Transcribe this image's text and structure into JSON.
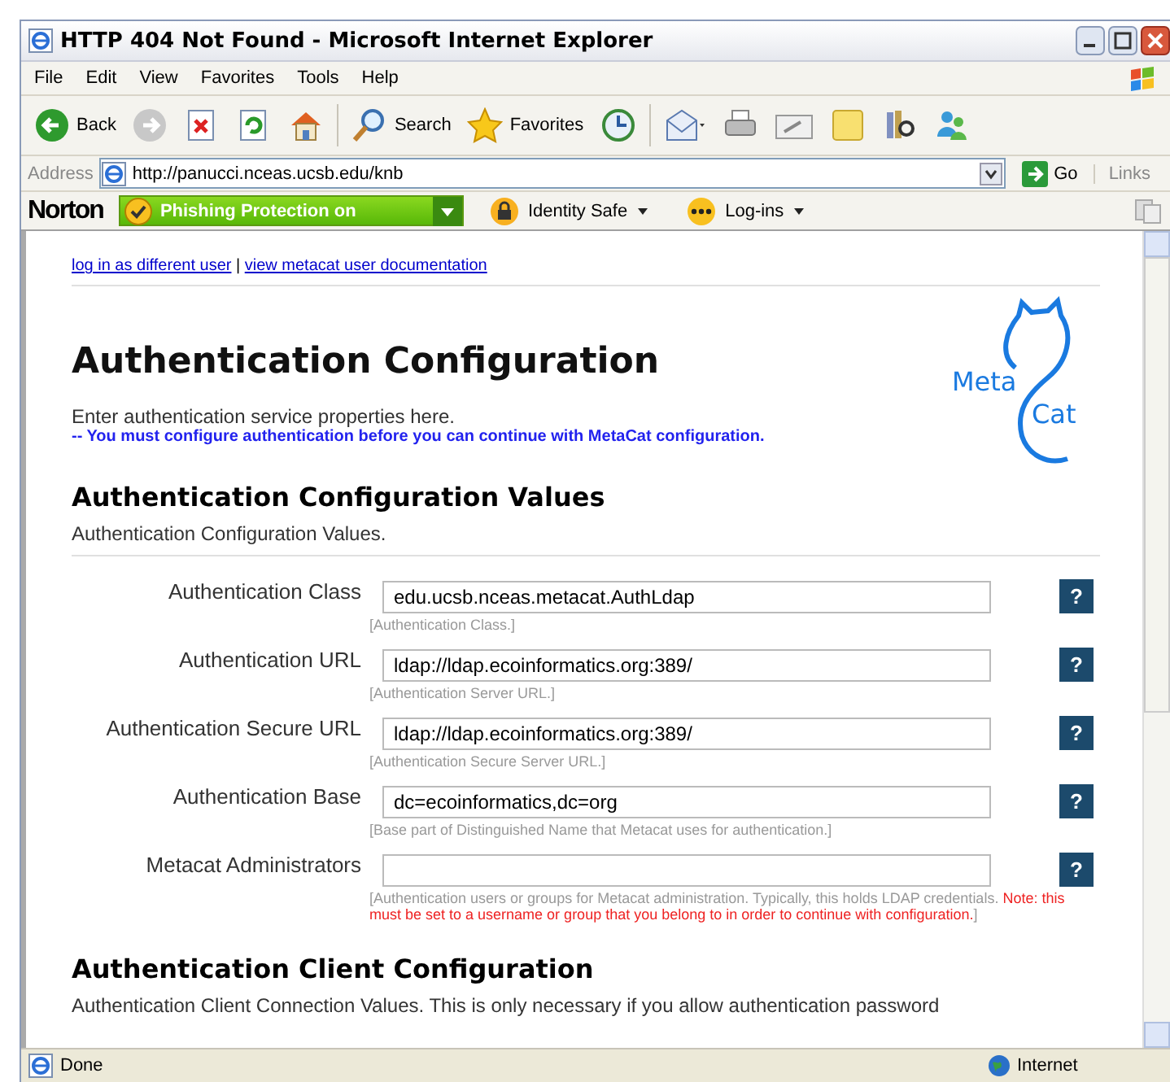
{
  "window": {
    "title": "HTTP 404 Not Found - Microsoft Internet Explorer"
  },
  "menu": [
    "File",
    "Edit",
    "View",
    "Favorites",
    "Tools",
    "Help"
  ],
  "toolbar": [
    {
      "kind": "back",
      "label": "Back"
    },
    {
      "kind": "forward"
    },
    {
      "kind": "stop"
    },
    {
      "kind": "refresh"
    },
    {
      "kind": "home"
    },
    {
      "kind": "search",
      "label": "Search"
    },
    {
      "kind": "favorites",
      "label": "Favorites"
    },
    {
      "kind": "history"
    },
    {
      "kind": "mail"
    },
    {
      "kind": "print"
    },
    {
      "kind": "edit"
    },
    {
      "kind": "note"
    },
    {
      "kind": "research"
    },
    {
      "kind": "messenger"
    }
  ],
  "address_bar": {
    "label": "Address",
    "url": "http://panucci.nceas.ucsb.edu/knb",
    "go": "Go",
    "links": "Links"
  },
  "norton_bar": {
    "brand": "Norton",
    "phishing": "Phishing Protection on",
    "identity": "Identity Safe",
    "logins": "Log-ins"
  },
  "page": {
    "top_links": [
      "log in as different user",
      "view metacat user documentation"
    ],
    "link_separator": "|",
    "title": "Authentication Configuration",
    "intro": "Enter authentication service properties here.",
    "warning": "--  You must configure authentication before you can continue with MetaCat configuration.",
    "logo": {
      "line1": "Meta",
      "line2": "Cat"
    },
    "section1": {
      "title": "Authentication Configuration Values",
      "description": "Authentication Configuration Values."
    },
    "fields": [
      {
        "label": "Authentication Class",
        "help": "?",
        "value": "edu.ucsb.nceas.metacat.AuthLdap",
        "hint": [
          {
            "kind": "plain",
            "text": "[Authentication Class.]"
          }
        ]
      },
      {
        "label": "Authentication URL",
        "help": "?",
        "value": "ldap://ldap.ecoinformatics.org:389/",
        "hint": [
          {
            "kind": "plain",
            "text": "[Authentication Server URL.]"
          }
        ]
      },
      {
        "label": "Authentication Secure URL",
        "help": "?",
        "value": "ldap://ldap.ecoinformatics.org:389/",
        "hint": [
          {
            "kind": "plain",
            "text": "[Authentication Secure Server URL.]"
          }
        ]
      },
      {
        "label": "Authentication Base",
        "help": "?",
        "value": "dc=ecoinformatics,dc=org",
        "hint": [
          {
            "kind": "plain",
            "text": "[Base part of Distinguished Name that Metacat uses for authentication.]"
          }
        ]
      },
      {
        "label": "Metacat Administrators",
        "help": "?",
        "hint": [
          {
            "kind": "plain",
            "text": "[Authentication users or groups for Metacat administration. Typically, this holds LDAP credentials. "
          },
          {
            "kind": "note",
            "text": "Note: this must be set to a username or group that you belong to in order to continue with configuration."
          },
          {
            "kind": "plain",
            "text": "]"
          }
        ]
      }
    ],
    "section2": {
      "title": "Authentication Client Configuration",
      "description": "Authentication Client Connection Values. This is only necessary if you allow authentication password"
    }
  },
  "status_bar": {
    "text": "Done",
    "zone": "Internet"
  }
}
